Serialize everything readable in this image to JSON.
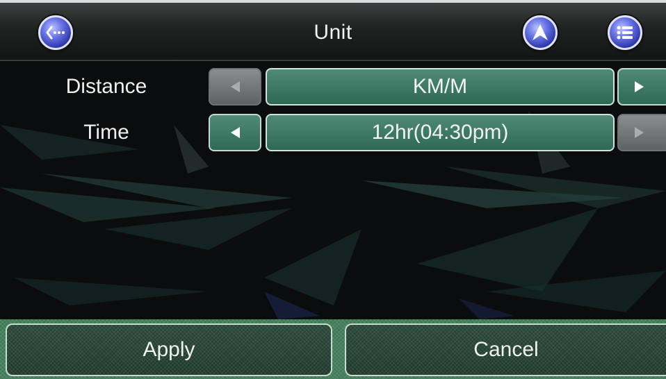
{
  "header": {
    "title": "Unit",
    "back_icon": "back-icon",
    "navigation_icon": "navigation-arrow-icon",
    "menu_icon": "list-menu-icon"
  },
  "settings": [
    {
      "label": "Distance",
      "value": "KM/M",
      "prev_enabled": false,
      "next_enabled": true
    },
    {
      "label": "Time",
      "value": "12hr(04:30pm)",
      "prev_enabled": true,
      "next_enabled": false
    }
  ],
  "footer": {
    "apply_label": "Apply",
    "cancel_label": "Cancel"
  },
  "colors": {
    "accent_green": "#3f7a56",
    "value_green": "#2e6954",
    "icon_blue": "#2b34a8"
  }
}
